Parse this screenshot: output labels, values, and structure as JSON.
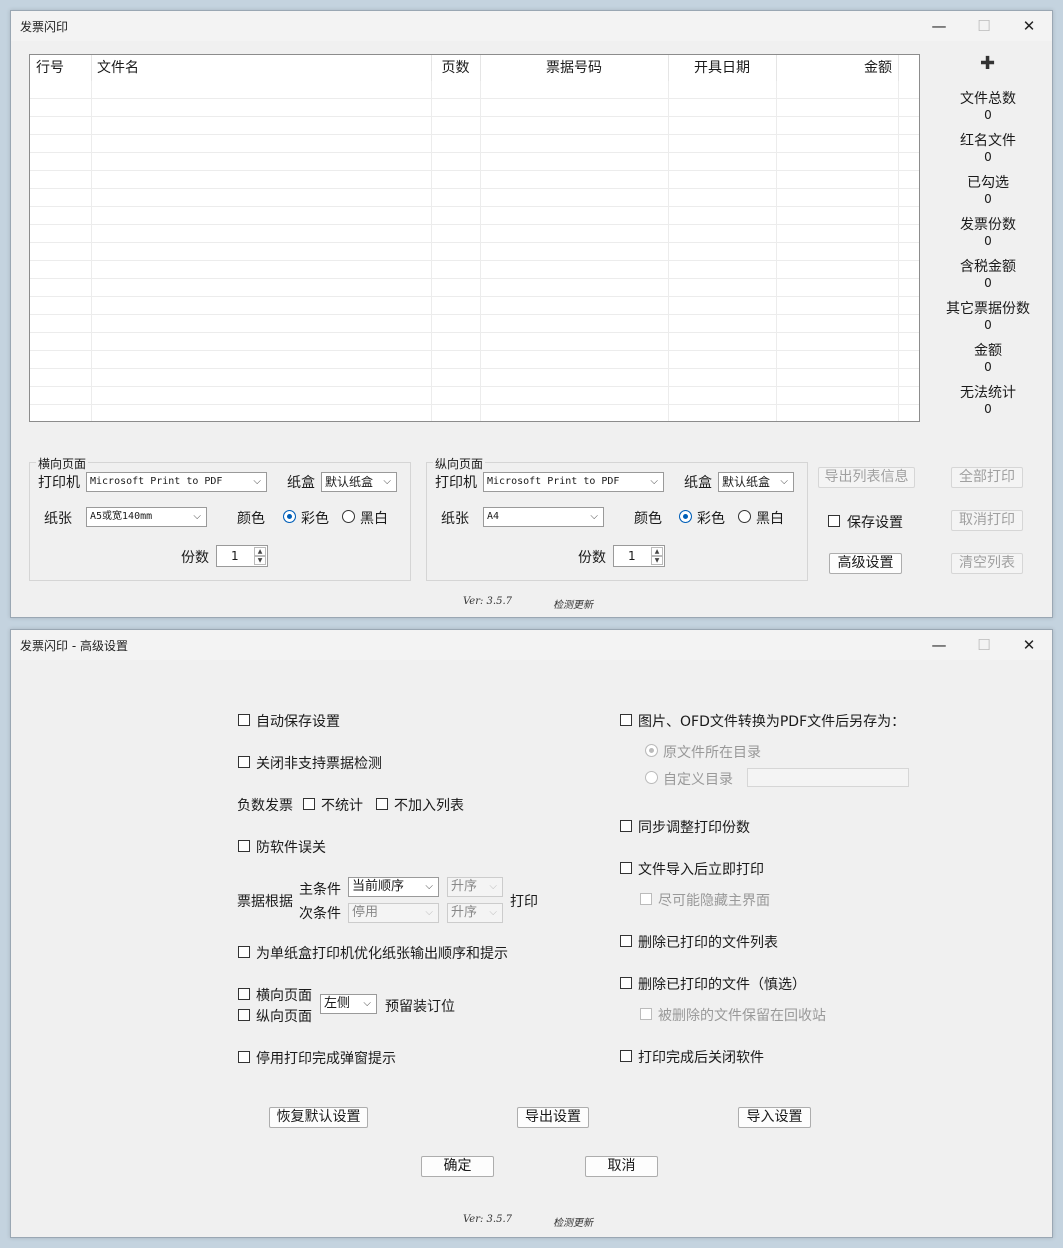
{
  "main": {
    "title": "发票闪印",
    "win_min": "—",
    "win_max": "☐",
    "win_close": "✕",
    "columns": [
      "行号",
      "文件名",
      "页数",
      "票据号码",
      "开具日期",
      "金额"
    ],
    "add_icon": "plus-icon",
    "stats": [
      {
        "label": "文件总数",
        "value": "0"
      },
      {
        "label": "红名文件",
        "value": "0"
      },
      {
        "label": "已勾选",
        "value": "0"
      },
      {
        "label": "发票份数",
        "value": "0"
      },
      {
        "label": "含税金额",
        "value": "0"
      },
      {
        "label": "其它票据份数",
        "value": "0"
      },
      {
        "label": "金额",
        "value": "0"
      },
      {
        "label": "无法统计",
        "value": "0"
      }
    ],
    "landscape": {
      "group_label": "横向页面",
      "printer_label": "打印机",
      "printer": "Microsoft Print to PDF",
      "tray_label": "纸盒",
      "tray": "默认纸盒",
      "paper_label": "纸张",
      "paper": "A5或宽140mm",
      "color_label": "颜色",
      "color_opt": "彩色",
      "bw_opt": "黑白",
      "copies_label": "份数",
      "copies": "1"
    },
    "portrait": {
      "group_label": "纵向页面",
      "printer_label": "打印机",
      "printer": "Microsoft Print to PDF",
      "tray_label": "纸盒",
      "tray": "默认纸盒",
      "paper_label": "纸张",
      "paper": "A4",
      "color_label": "颜色",
      "color_opt": "彩色",
      "bw_opt": "黑白",
      "copies_label": "份数",
      "copies": "1"
    },
    "export_list_info": "导出列表信息",
    "print_all": "全部打印",
    "save_settings": "保存设置",
    "cancel_print": "取消打印",
    "advanced": "高级设置",
    "clear_list": "清空列表",
    "version": "Ver: 3.5.7",
    "check_update": "检测更新"
  },
  "adv": {
    "title": "发票闪印 - 高级设置",
    "win_min": "—",
    "win_max": "☐",
    "win_close": "✕",
    "auto_save": "自动保存设置",
    "close_unsupported": "关闭非支持票据检测",
    "negative_label": "负数发票",
    "no_stat": "不统计",
    "no_list": "不加入列表",
    "anti_close": "防软件误关",
    "sort_by": "票据根据",
    "primary_label": "主条件",
    "primary_value": "当前顺序",
    "primary_order": "升序",
    "secondary_label": "次条件",
    "secondary_value": "停用",
    "secondary_order": "升序",
    "print_label": "打印",
    "single_tray": "为单纸盒打印机优化纸张输出顺序和提示",
    "landscape_page": "横向页面",
    "portrait_page": "纵向页面",
    "binding_side": "左侧",
    "binding_label": "预留装订位",
    "disable_popup": "停用打印完成弹窗提示",
    "convert_save": "图片、OFD文件转换为PDF文件后另存为：",
    "orig_dir": "原文件所在目录",
    "custom_dir": "自定义目录",
    "sync_copies": "同步调整打印份数",
    "print_on_import": "文件导入后立即打印",
    "hide_main": "尽可能隐藏主界面",
    "delete_printed_list": "删除已打印的文件列表",
    "delete_printed_files": "删除已打印的文件（慎选）",
    "keep_recycle": "被删除的文件保留在回收站",
    "close_after_print": "打印完成后关闭软件",
    "restore_default": "恢复默认设置",
    "export_settings": "导出设置",
    "import_settings": "导入设置",
    "ok": "确定",
    "cancel": "取消",
    "version": "Ver: 3.5.7",
    "check_update": "检测更新"
  }
}
